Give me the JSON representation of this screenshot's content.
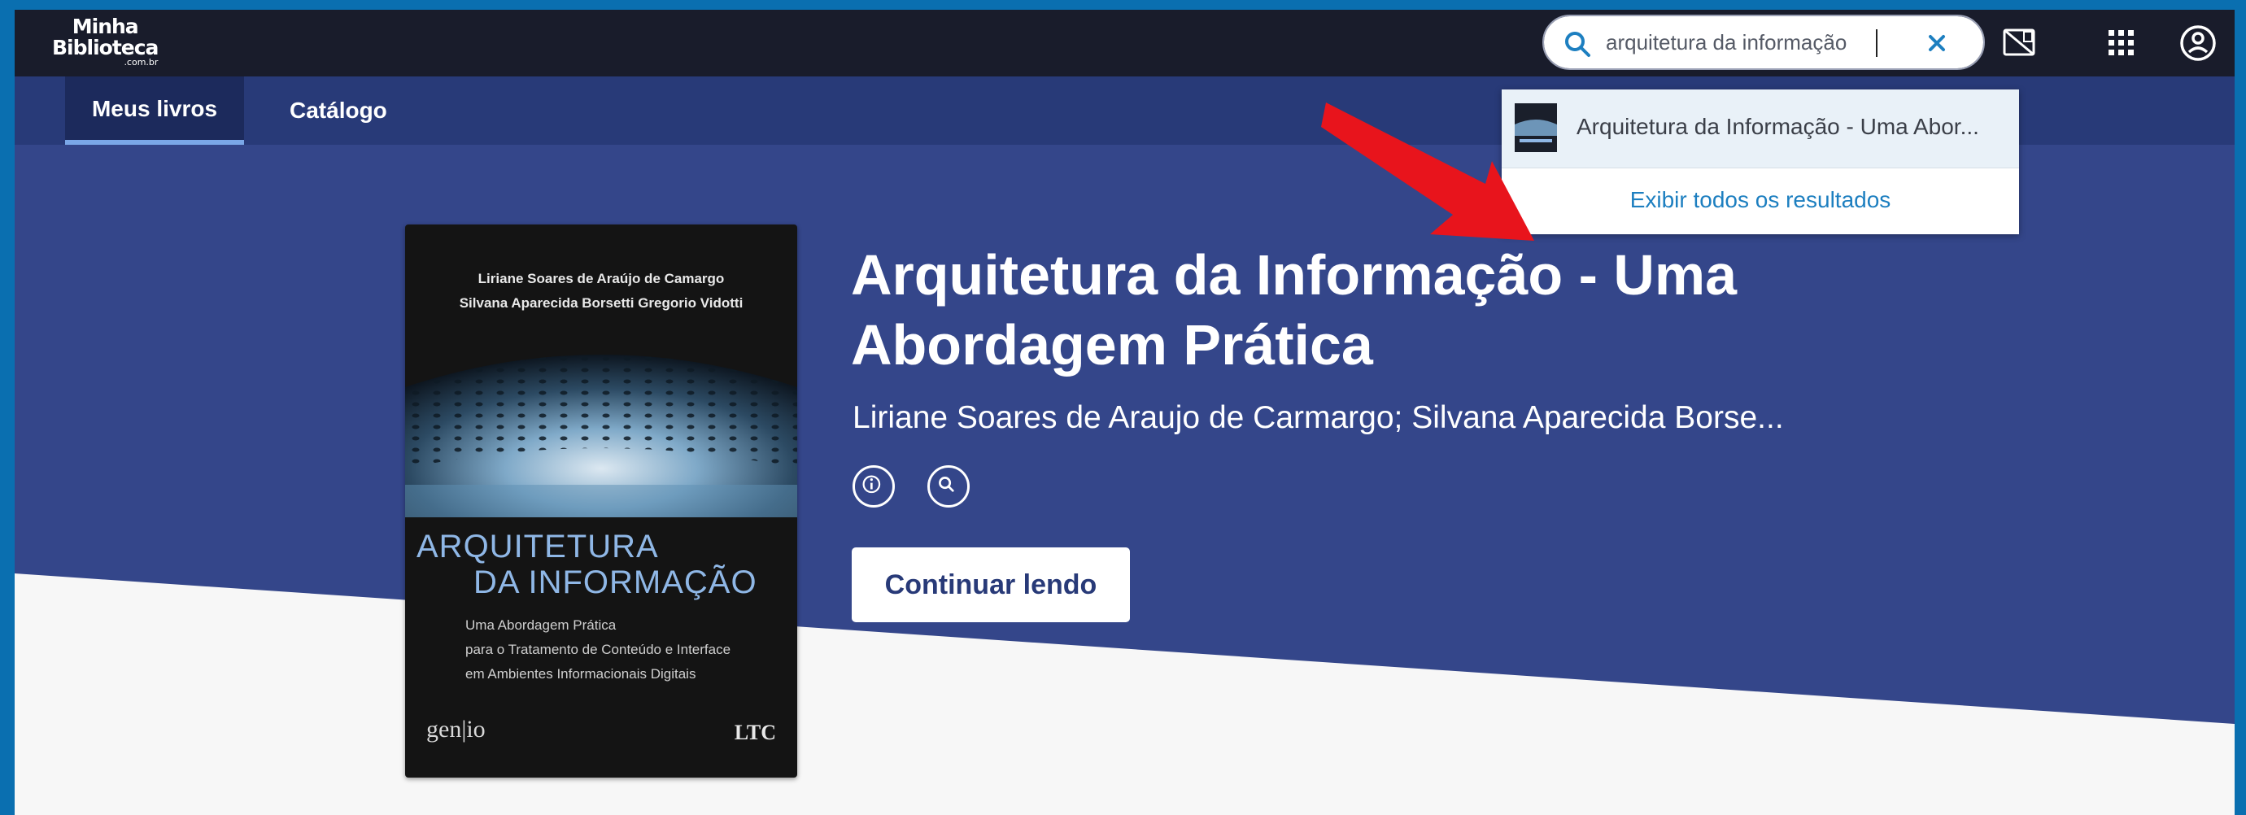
{
  "brand": {
    "line1": "Minha",
    "line2": "Biblioteca",
    "line3": ".com.br"
  },
  "search": {
    "value": "arquitetura da informação",
    "placeholder": ""
  },
  "header_icons": [
    "tablet-book-icon",
    "apps-grid-icon",
    "account-circle-icon"
  ],
  "nav": {
    "tabs": [
      {
        "label": "Meus livros",
        "active": true
      },
      {
        "label": "Catálogo",
        "active": false
      }
    ]
  },
  "search_results": {
    "items": [
      {
        "label": "Arquitetura da Informação - Uma Abor..."
      }
    ],
    "show_all_label": "Exibir todos os resultados"
  },
  "book": {
    "title": "Arquitetura da Informação - Uma Abordagem Prática",
    "authors": "Liriane Soares de Araujo de Carmargo; Silvana Aparecida Borse...",
    "continue_label": "Continuar lendo",
    "cover": {
      "author1": "Liriane Soares de Araújo de Camargo",
      "author2": "Silvana Aparecida Borsetti Gregorio Vidotti",
      "title_line1": "ARQUITETURA",
      "title_line2": "DA INFORMAÇÃO",
      "subtitle1": "Uma Abordagem Prática",
      "subtitle2": "para o Tratamento de Conteúdo e Interface",
      "subtitle3": "em Ambientes Informacionais Digitais",
      "publisher1": "gen|io",
      "publisher2": "LTC"
    }
  },
  "colors": {
    "topbar": "#191c2b",
    "nav": "#283a78",
    "hero": "#34468a",
    "accent": "#1d7fc0",
    "annotation_arrow": "#e8141c"
  }
}
